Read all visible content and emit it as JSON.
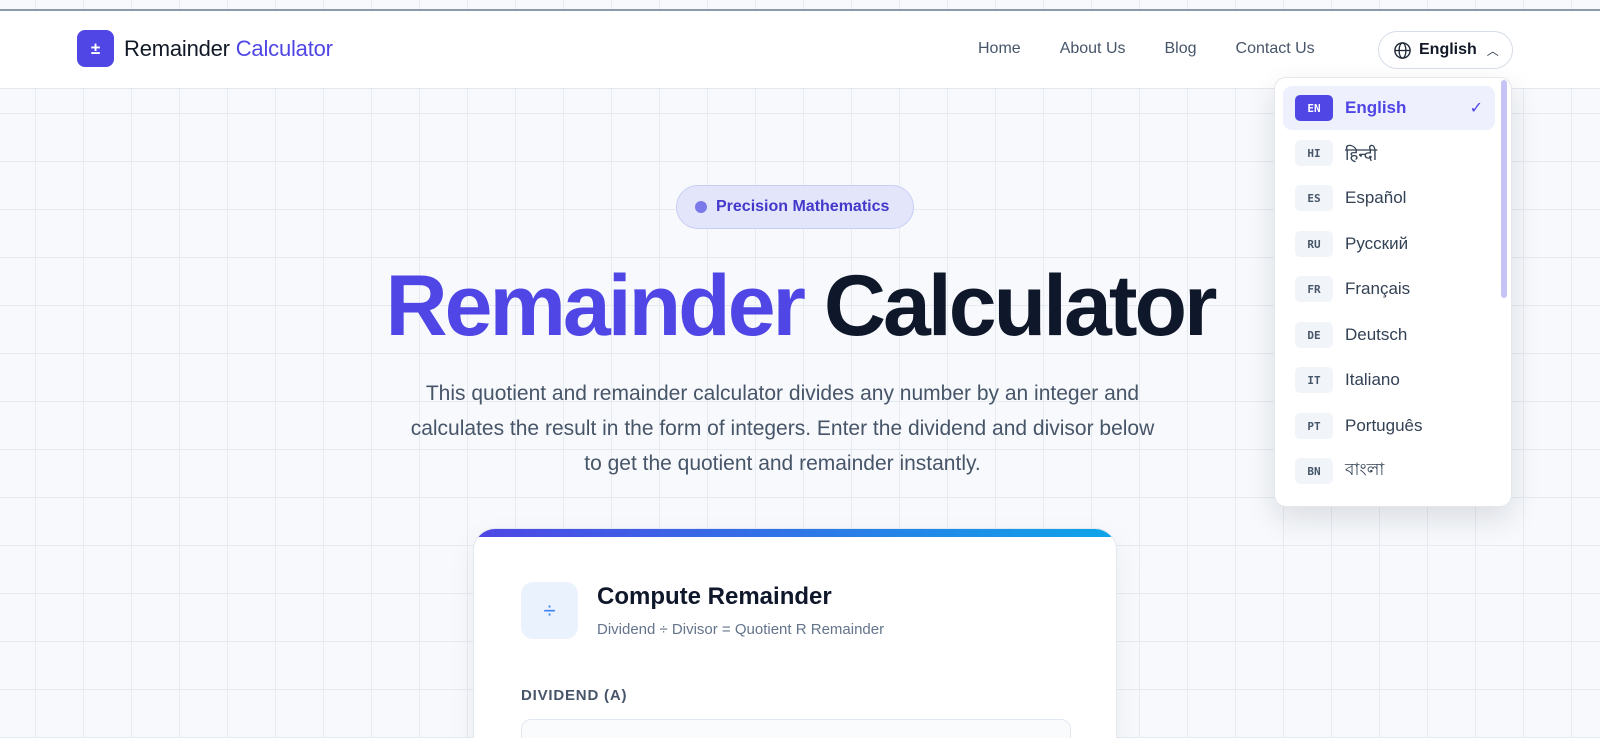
{
  "header": {
    "logo_icon": "plus-minus-icon",
    "logo_prefix": "Remainder",
    "logo_accent": "Calculator",
    "nav": [
      "Home",
      "About Us",
      "Blog",
      "Contact Us"
    ],
    "language_button": "English",
    "colors": {
      "accent": "#4f46e5",
      "dark": "#0f172a"
    }
  },
  "language_menu": {
    "items": [
      {
        "code": "EN",
        "name": "English",
        "selected": true
      },
      {
        "code": "HI",
        "name": "हिन्दी",
        "selected": false
      },
      {
        "code": "ES",
        "name": "Español",
        "selected": false
      },
      {
        "code": "RU",
        "name": "Русский",
        "selected": false
      },
      {
        "code": "FR",
        "name": "Français",
        "selected": false
      },
      {
        "code": "DE",
        "name": "Deutsch",
        "selected": false
      },
      {
        "code": "IT",
        "name": "Italiano",
        "selected": false
      },
      {
        "code": "PT",
        "name": "Português",
        "selected": false
      },
      {
        "code": "BN",
        "name": "বাংলা",
        "selected": false
      }
    ]
  },
  "hero": {
    "badge": "Precision Mathematics",
    "title_accent": "Remainder",
    "title_dark": "Calculator",
    "description": "This quotient and remainder calculator divides any number by an integer and calculates the result in the form of integers. Enter the dividend and divisor below to get the quotient and remainder instantly."
  },
  "calculator_card": {
    "icon": "divide-icon",
    "title": "Compute Remainder",
    "subtitle": "Dividend ÷ Divisor = Quotient R Remainder",
    "dividend_label": "DIVIDEND (A)"
  }
}
